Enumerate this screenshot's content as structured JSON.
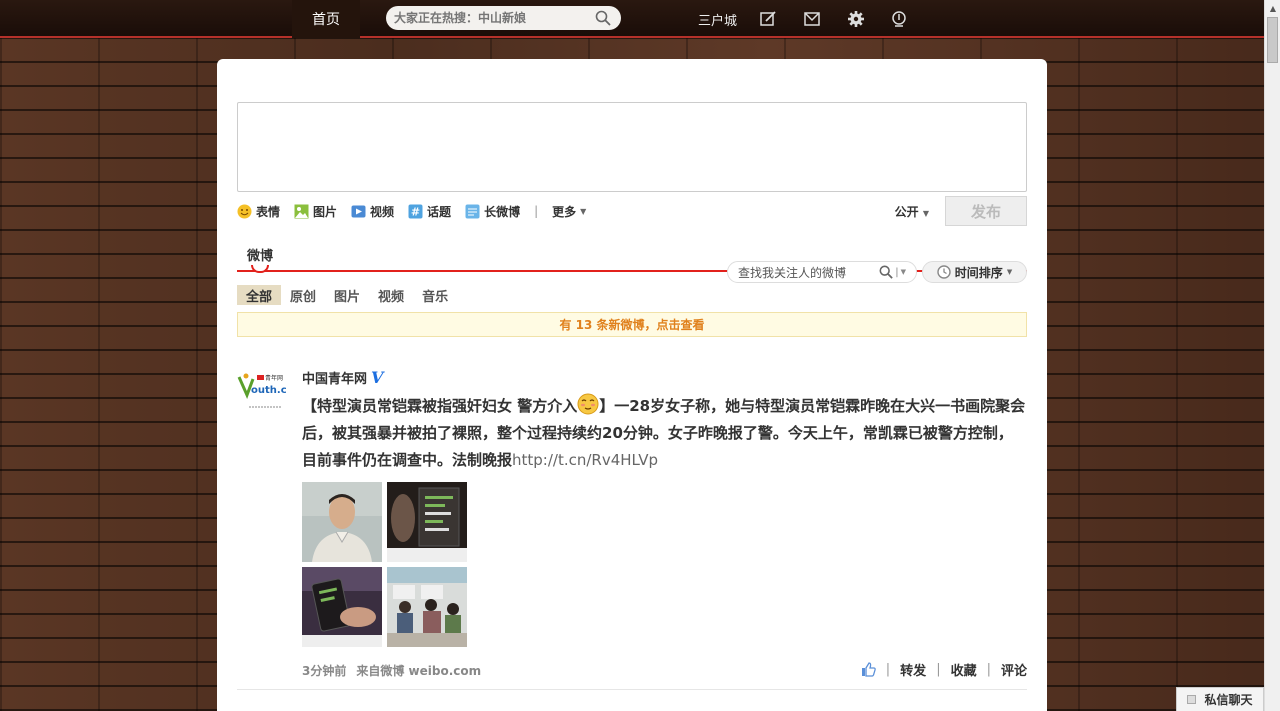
{
  "topbar": {
    "home": "首页",
    "search_placeholder": "大家正在热搜：中山新娘",
    "app_link": "三户城",
    "icons": [
      "edit-icon",
      "mail-icon",
      "gear-icon",
      "app-icon"
    ]
  },
  "composer": {
    "tools": [
      {
        "label": "表情",
        "icon": "emoji-icon"
      },
      {
        "label": "图片",
        "icon": "image-icon"
      },
      {
        "label": "视频",
        "icon": "video-icon"
      },
      {
        "label": "话题",
        "icon": "topic-icon"
      },
      {
        "label": "长微博",
        "icon": "long-post-icon"
      }
    ],
    "more": "更多",
    "privacy": "公开",
    "post_button": "发布"
  },
  "feed_header": {
    "tab": "微博",
    "search_placeholder": "查找我关注人的微博",
    "sort": "时间排序"
  },
  "subtabs": [
    "全部",
    "原创",
    "图片",
    "视频",
    "音乐"
  ],
  "new_posts_bar": "有 13 条新微博，点击查看",
  "post": {
    "author": "中国青年网",
    "verified_mark": "V",
    "text_a": "【特型演员常铠霖被指强奸妇女 警方介入",
    "text_b": "】一28岁女子称，她与特型演员常铠霖昨晚在大兴一书画院聚会后，被其强暴并被拍了裸照，整个过程持续约20分钟。女子昨晚报了警。今天上午，常凯霖已被警方控制，目前事件仍在调查中。法制晚报",
    "link": "http://t.cn/Rv4HLVp",
    "time": "3分钟前",
    "source": "来自微博 weibo.com",
    "repost": "转发",
    "favorite": "收藏",
    "comment": "评论"
  },
  "chat": {
    "label": "私信聊天"
  },
  "colors": {
    "accent_red": "#e2211c",
    "notice_orange": "#e0811d",
    "verified_blue": "#1d6fe0"
  }
}
